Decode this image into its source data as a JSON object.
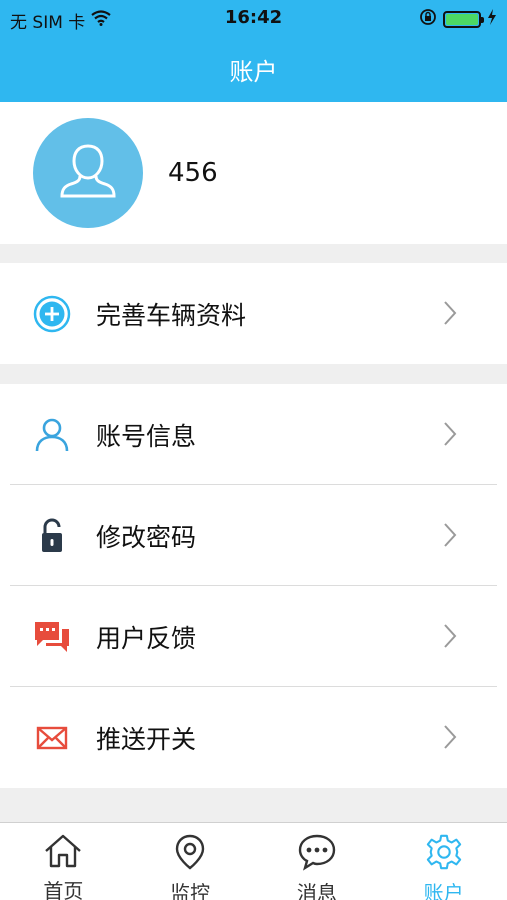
{
  "status_bar": {
    "carrier": "无 SIM 卡",
    "time": "16:42"
  },
  "nav": {
    "title": "账户"
  },
  "profile": {
    "username": "456"
  },
  "menu_primary": [
    {
      "label": "完善车辆资料",
      "icon": "add-circle-icon"
    }
  ],
  "menu_secondary": [
    {
      "label": "账号信息",
      "icon": "person-icon"
    },
    {
      "label": "修改密码",
      "icon": "lock-icon"
    },
    {
      "label": "用户反馈",
      "icon": "chat-bubbles-icon"
    },
    {
      "label": "推送开关",
      "icon": "envelope-icon"
    }
  ],
  "tabs": [
    {
      "label": "首页",
      "icon": "home-icon",
      "active": false
    },
    {
      "label": "监控",
      "icon": "location-pin-icon",
      "active": false
    },
    {
      "label": "消息",
      "icon": "message-icon",
      "active": false
    },
    {
      "label": "账户",
      "icon": "gear-icon",
      "active": true
    }
  ],
  "colors": {
    "accent": "#2fb7f0",
    "avatar_bg": "#62bfe8",
    "battery": "#4cd964",
    "red_icon": "#e74c3c"
  }
}
